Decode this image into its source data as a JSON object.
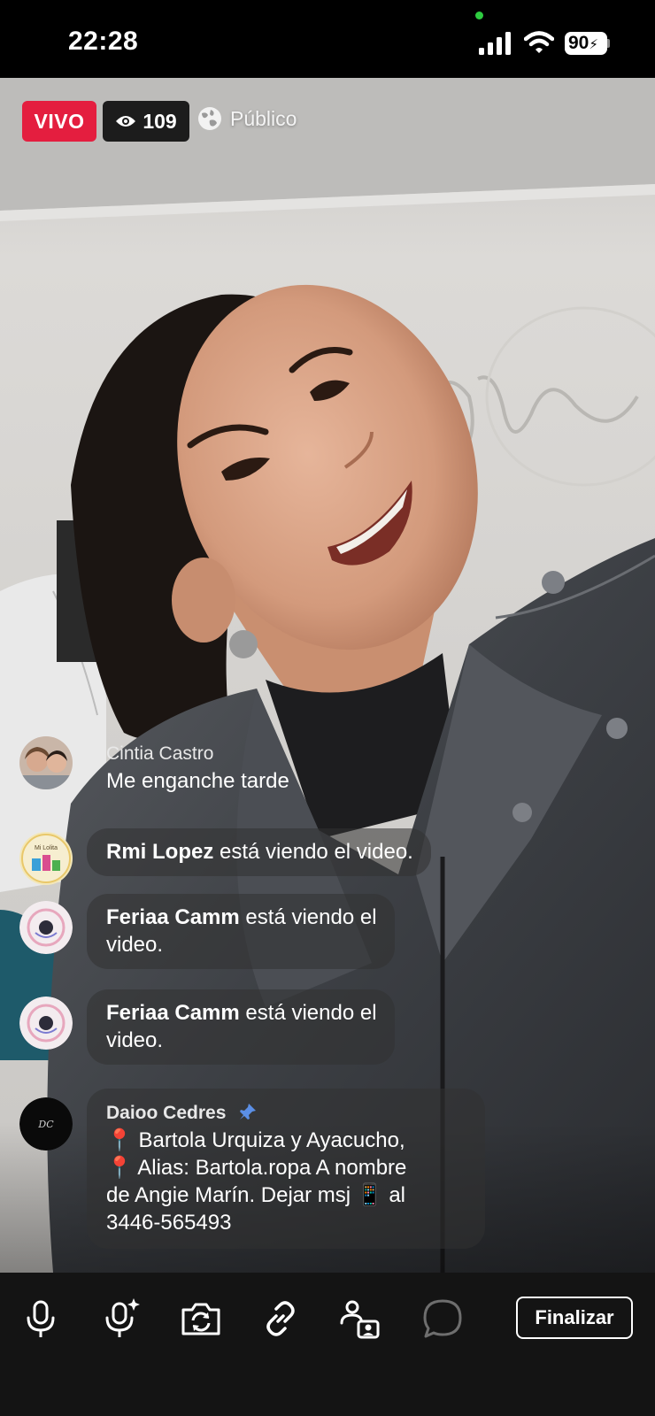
{
  "status_bar": {
    "time": "22:28",
    "battery": "90",
    "icons": [
      "signal-icon",
      "wifi-icon",
      "battery-charging-icon"
    ]
  },
  "live": {
    "badge": "VIVO",
    "viewer_count": "109",
    "privacy": "Público",
    "colors": {
      "live_red": "#e41e3f"
    }
  },
  "comments": [
    {
      "name": "Cintia Castro",
      "text": "Me enganche tarde"
    },
    {
      "name": "Rmi Lopez",
      "text": "está viendo el video."
    },
    {
      "name": "Feriaa Camm",
      "text": "está viendo el",
      "text2": "video."
    },
    {
      "name": "Feriaa Camm",
      "text": "está viendo el",
      "text2": "video."
    },
    {
      "name": "Daioo Cedres",
      "pinned": true,
      "line1": "📍 Bartola Urquiza y Ayacucho,",
      "line2": "📍 Alias: Bartola.ropa A nombre",
      "line3": "de Angie Marín. Dejar msj 📱 al",
      "line4": "3446-565493"
    }
  ],
  "toolbar": {
    "icons": [
      "microphone-icon",
      "mic-effects-icon",
      "flip-camera-icon",
      "link-icon",
      "guest-icon",
      "comment-icon"
    ],
    "finalize_label": "Finalizar"
  }
}
